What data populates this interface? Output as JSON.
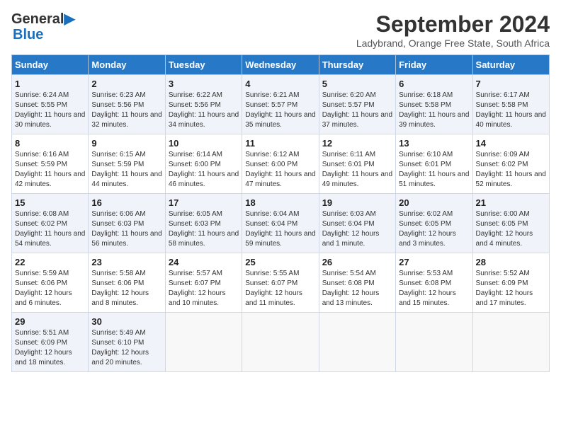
{
  "header": {
    "logo_line1": "General",
    "logo_line2": "Blue",
    "month": "September 2024",
    "location": "Ladybrand, Orange Free State, South Africa"
  },
  "weekdays": [
    "Sunday",
    "Monday",
    "Tuesday",
    "Wednesday",
    "Thursday",
    "Friday",
    "Saturday"
  ],
  "weeks": [
    [
      {
        "day": "1",
        "sunrise": "6:24 AM",
        "sunset": "5:55 PM",
        "daylight": "11 hours and 30 minutes."
      },
      {
        "day": "2",
        "sunrise": "6:23 AM",
        "sunset": "5:56 PM",
        "daylight": "11 hours and 32 minutes."
      },
      {
        "day": "3",
        "sunrise": "6:22 AM",
        "sunset": "5:56 PM",
        "daylight": "11 hours and 34 minutes."
      },
      {
        "day": "4",
        "sunrise": "6:21 AM",
        "sunset": "5:57 PM",
        "daylight": "11 hours and 35 minutes."
      },
      {
        "day": "5",
        "sunrise": "6:20 AM",
        "sunset": "5:57 PM",
        "daylight": "11 hours and 37 minutes."
      },
      {
        "day": "6",
        "sunrise": "6:18 AM",
        "sunset": "5:58 PM",
        "daylight": "11 hours and 39 minutes."
      },
      {
        "day": "7",
        "sunrise": "6:17 AM",
        "sunset": "5:58 PM",
        "daylight": "11 hours and 40 minutes."
      }
    ],
    [
      {
        "day": "8",
        "sunrise": "6:16 AM",
        "sunset": "5:59 PM",
        "daylight": "11 hours and 42 minutes."
      },
      {
        "day": "9",
        "sunrise": "6:15 AM",
        "sunset": "5:59 PM",
        "daylight": "11 hours and 44 minutes."
      },
      {
        "day": "10",
        "sunrise": "6:14 AM",
        "sunset": "6:00 PM",
        "daylight": "11 hours and 46 minutes."
      },
      {
        "day": "11",
        "sunrise": "6:12 AM",
        "sunset": "6:00 PM",
        "daylight": "11 hours and 47 minutes."
      },
      {
        "day": "12",
        "sunrise": "6:11 AM",
        "sunset": "6:01 PM",
        "daylight": "11 hours and 49 minutes."
      },
      {
        "day": "13",
        "sunrise": "6:10 AM",
        "sunset": "6:01 PM",
        "daylight": "11 hours and 51 minutes."
      },
      {
        "day": "14",
        "sunrise": "6:09 AM",
        "sunset": "6:02 PM",
        "daylight": "11 hours and 52 minutes."
      }
    ],
    [
      {
        "day": "15",
        "sunrise": "6:08 AM",
        "sunset": "6:02 PM",
        "daylight": "11 hours and 54 minutes."
      },
      {
        "day": "16",
        "sunrise": "6:06 AM",
        "sunset": "6:03 PM",
        "daylight": "11 hours and 56 minutes."
      },
      {
        "day": "17",
        "sunrise": "6:05 AM",
        "sunset": "6:03 PM",
        "daylight": "11 hours and 58 minutes."
      },
      {
        "day": "18",
        "sunrise": "6:04 AM",
        "sunset": "6:04 PM",
        "daylight": "11 hours and 59 minutes."
      },
      {
        "day": "19",
        "sunrise": "6:03 AM",
        "sunset": "6:04 PM",
        "daylight": "12 hours and 1 minute."
      },
      {
        "day": "20",
        "sunrise": "6:02 AM",
        "sunset": "6:05 PM",
        "daylight": "12 hours and 3 minutes."
      },
      {
        "day": "21",
        "sunrise": "6:00 AM",
        "sunset": "6:05 PM",
        "daylight": "12 hours and 4 minutes."
      }
    ],
    [
      {
        "day": "22",
        "sunrise": "5:59 AM",
        "sunset": "6:06 PM",
        "daylight": "12 hours and 6 minutes."
      },
      {
        "day": "23",
        "sunrise": "5:58 AM",
        "sunset": "6:06 PM",
        "daylight": "12 hours and 8 minutes."
      },
      {
        "day": "24",
        "sunrise": "5:57 AM",
        "sunset": "6:07 PM",
        "daylight": "12 hours and 10 minutes."
      },
      {
        "day": "25",
        "sunrise": "5:55 AM",
        "sunset": "6:07 PM",
        "daylight": "12 hours and 11 minutes."
      },
      {
        "day": "26",
        "sunrise": "5:54 AM",
        "sunset": "6:08 PM",
        "daylight": "12 hours and 13 minutes."
      },
      {
        "day": "27",
        "sunrise": "5:53 AM",
        "sunset": "6:08 PM",
        "daylight": "12 hours and 15 minutes."
      },
      {
        "day": "28",
        "sunrise": "5:52 AM",
        "sunset": "6:09 PM",
        "daylight": "12 hours and 17 minutes."
      }
    ],
    [
      {
        "day": "29",
        "sunrise": "5:51 AM",
        "sunset": "6:09 PM",
        "daylight": "12 hours and 18 minutes."
      },
      {
        "day": "30",
        "sunrise": "5:49 AM",
        "sunset": "6:10 PM",
        "daylight": "12 hours and 20 minutes."
      },
      null,
      null,
      null,
      null,
      null
    ]
  ]
}
